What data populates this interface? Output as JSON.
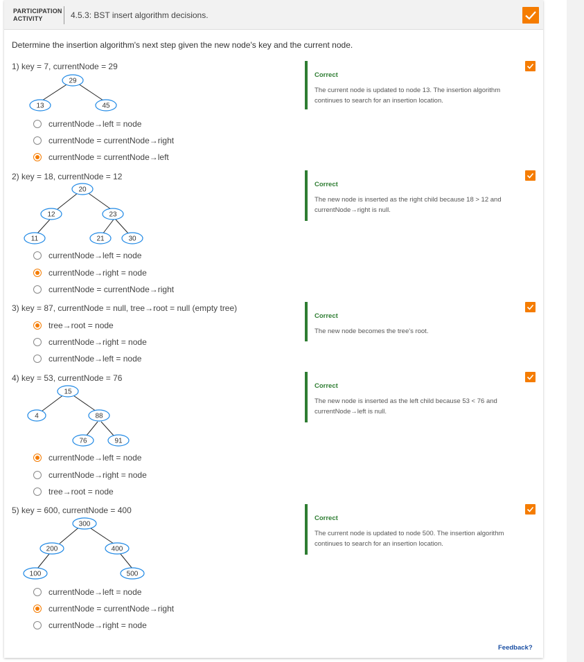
{
  "header": {
    "activity_label_line1": "PARTICIPATION",
    "activity_label_line2": "ACTIVITY",
    "title": "4.5.3: BST insert algorithm decisions.",
    "complete_icon": "check-icon",
    "accent_color": "#f57c00"
  },
  "intro": "Determine the insertion algorithm's next step given the new node's key and the current node.",
  "questions": [
    {
      "prompt": "1) key = 7, currentNode = 29",
      "nodes": [
        "29",
        "13",
        "45"
      ],
      "options": [
        "currentNode→left = node",
        "currentNode = currentNode→right",
        "currentNode = currentNode→left"
      ],
      "selected": 2,
      "feedback_title": "Correct",
      "feedback": "The current node is updated to node 13. The insertion algorithm continues to search for an insertion location."
    },
    {
      "prompt": "2) key = 18, currentNode = 12",
      "nodes": [
        "20",
        "12",
        "23",
        "11",
        "21",
        "30"
      ],
      "options": [
        "currentNode→left = node",
        "currentNode→right = node",
        "currentNode = currentNode→right"
      ],
      "selected": 1,
      "feedback_title": "Correct",
      "feedback": "The new node is inserted as the right child because 18 > 12 and currentNode→right is null."
    },
    {
      "prompt": "3) key = 87, currentNode = null, tree→root = null (empty tree)",
      "nodes": [],
      "options": [
        "tree→root = node",
        "currentNode→right = node",
        "currentNode→left = node"
      ],
      "selected": 0,
      "feedback_title": "Correct",
      "feedback": "The new node becomes the tree's root."
    },
    {
      "prompt": "4) key = 53, currentNode = 76",
      "nodes": [
        "15",
        "4",
        "88",
        "76",
        "91"
      ],
      "options": [
        "currentNode→left = node",
        "currentNode→right = node",
        "tree→root = node"
      ],
      "selected": 0,
      "feedback_title": "Correct",
      "feedback": "The new node is inserted as the left child because 53 < 76 and currentNode→left is null."
    },
    {
      "prompt": "5) key = 600, currentNode = 400",
      "nodes": [
        "300",
        "200",
        "400",
        "100",
        "500"
      ],
      "options": [
        "currentNode→left = node",
        "currentNode = currentNode→right",
        "currentNode→right = node"
      ],
      "selected": 1,
      "feedback_title": "Correct",
      "feedback": "The current node is updated to node 500. The insertion algorithm continues to search for an insertion location."
    }
  ],
  "feedback_link": "Feedback?",
  "colors": {
    "correct": "#2e7d32",
    "link": "#1a4fa3",
    "node_border": "#1e88e5"
  }
}
